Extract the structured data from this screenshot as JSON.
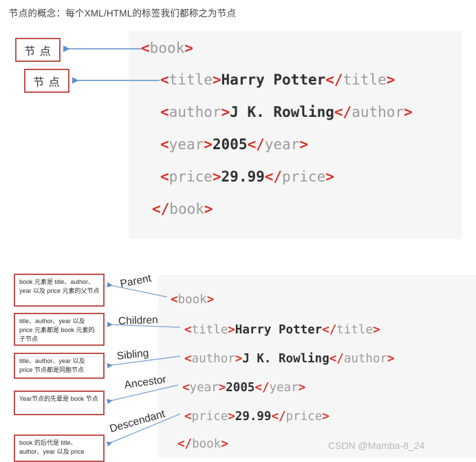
{
  "heading": "节点的概念：每个XML/HTML的标签我们都称之为节点",
  "colors": {
    "bracket_red": "#d93025",
    "tag_gray": "#9b9b9b",
    "text_dark": "#2f2f2f",
    "box_border_red": "#c0504d",
    "arrow_blue": "#5b8fc9",
    "panel_bg": "#f6f6f6",
    "watermark_gray": "#b9b9b9"
  },
  "code_top": {
    "lines": [
      {
        "indent": 0,
        "open_lt": "<",
        "open_tag": "book",
        "open_gt": ">",
        "text": "",
        "close": ""
      },
      {
        "indent": 1,
        "open_lt": "<",
        "open_tag": "title",
        "open_gt": ">",
        "text": "Harry Potter",
        "close_lt": "</",
        "close_tag": "title",
        "close_gt": ">"
      },
      {
        "indent": 1,
        "open_lt": "<",
        "open_tag": "author",
        "open_gt": ">",
        "text": "J K. Rowling",
        "close_lt": "</",
        "close_tag": "author",
        "close_gt": ">"
      },
      {
        "indent": 1,
        "open_lt": "<",
        "open_tag": "year",
        "open_gt": ">",
        "text": "2005",
        "close_lt": "</",
        "close_tag": "year",
        "close_gt": ">"
      },
      {
        "indent": 1,
        "open_lt": "<",
        "open_tag": "price",
        "open_gt": ">",
        "text": "29.99",
        "close_lt": "</",
        "close_tag": "price",
        "close_gt": ">"
      },
      {
        "indent": 0,
        "close_lt": "</",
        "close_tag": "book",
        "close_gt": ">"
      }
    ]
  },
  "code_bottom": {
    "lines": [
      {
        "open_lt": "<",
        "open_tag": "book",
        "open_gt": ">"
      },
      {
        "open_lt": "<",
        "open_tag": "title",
        "open_gt": ">",
        "text": "Harry Potter",
        "close_lt": "</",
        "close_tag": "title",
        "close_gt": ">"
      },
      {
        "open_lt": "<",
        "open_tag": "author",
        "open_gt": ">",
        "text": "J K. Rowling",
        "close_lt": "</",
        "close_tag": "author",
        "close_gt": ">"
      },
      {
        "open_lt": "<",
        "open_tag": "year",
        "open_gt": ">",
        "text": "2005",
        "close_lt": "</",
        "close_tag": "year",
        "close_gt": ">"
      },
      {
        "open_lt": "<",
        "open_tag": "price",
        "open_gt": ">",
        "text": "29.99",
        "close_lt": "</",
        "close_tag": "price",
        "close_gt": ">"
      },
      {
        "close_lt": "</",
        "close_tag": "book",
        "close_gt": ">"
      }
    ]
  },
  "node_boxes": [
    {
      "label": "节 点"
    },
    {
      "label": "节 点"
    }
  ],
  "relationship_labels": [
    {
      "key": "parent",
      "label": "Parent"
    },
    {
      "key": "children",
      "label": "Children"
    },
    {
      "key": "sibling",
      "label": "Sibling"
    },
    {
      "key": "ancestor",
      "label": "Ancestor"
    },
    {
      "key": "descendant",
      "label": "Descendant"
    }
  ],
  "description_boxes": [
    {
      "key": "parent",
      "text": "book 元素是 title、author、year 以及 price 元素的父节点"
    },
    {
      "key": "children",
      "text": "title、author、year 以及 price 元素都是 book 元素的子节点"
    },
    {
      "key": "sibling",
      "text": "title、author、year 以及 price 节点都是同胞节点"
    },
    {
      "key": "ancestor",
      "text": "Year节点的先辈是 book 节点"
    },
    {
      "key": "descendant",
      "text": "book 的后代是 title、author、year 以及 price"
    }
  ],
  "watermark": "CSDN @Mamba-8_24"
}
